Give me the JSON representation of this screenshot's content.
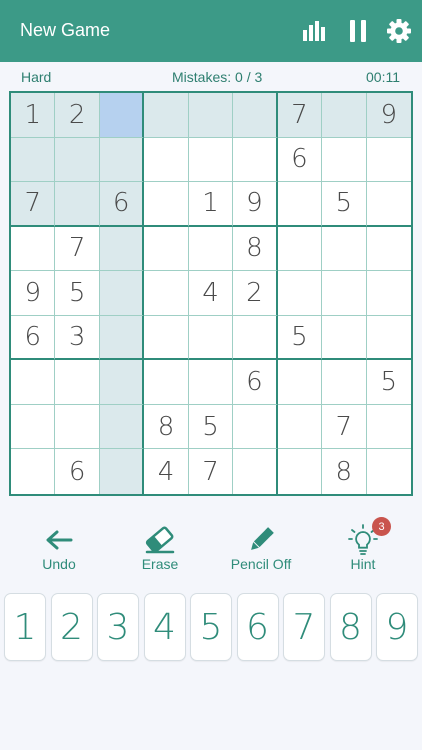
{
  "header": {
    "title": "New Game",
    "icons": [
      "bar-chart-icon",
      "pause-icon",
      "gear-icon"
    ],
    "background": "#3c9a87"
  },
  "status": {
    "difficulty": "Hard",
    "mistakes": "Mistakes: 0 / 3",
    "timer": "00:11"
  },
  "board": {
    "selected": {
      "row": 0,
      "col": 2
    },
    "cells": [
      [
        "1",
        "2",
        "",
        "",
        "",
        "",
        "7",
        "",
        "9"
      ],
      [
        "",
        "",
        "",
        "",
        "",
        "",
        "6",
        "",
        ""
      ],
      [
        "7",
        "",
        "6",
        "",
        "1",
        "9",
        "",
        "5",
        ""
      ],
      [
        "",
        "7",
        "",
        "",
        "",
        "8",
        "",
        "",
        ""
      ],
      [
        "9",
        "5",
        "",
        "",
        "4",
        "2",
        "",
        "",
        ""
      ],
      [
        "6",
        "3",
        "",
        "",
        "",
        "",
        "5",
        "",
        ""
      ],
      [
        "",
        "",
        "",
        "",
        "",
        "6",
        "",
        "",
        "5"
      ],
      [
        "",
        "",
        "",
        "8",
        "5",
        "",
        "",
        "7",
        ""
      ],
      [
        "",
        "6",
        "",
        "4",
        "7",
        "",
        "",
        "8",
        ""
      ]
    ]
  },
  "tools": {
    "undo": "Undo",
    "erase": "Erase",
    "pencil": "Pencil Off",
    "hint": "Hint",
    "hint_count": "3"
  },
  "numpad": [
    "1",
    "2",
    "3",
    "4",
    "5",
    "6",
    "7",
    "8",
    "9"
  ],
  "colors": {
    "accent": "#2f8c7a",
    "highlight": "#dbe9ec",
    "selected": "#b6d1ef",
    "badge": "#c9544d"
  }
}
